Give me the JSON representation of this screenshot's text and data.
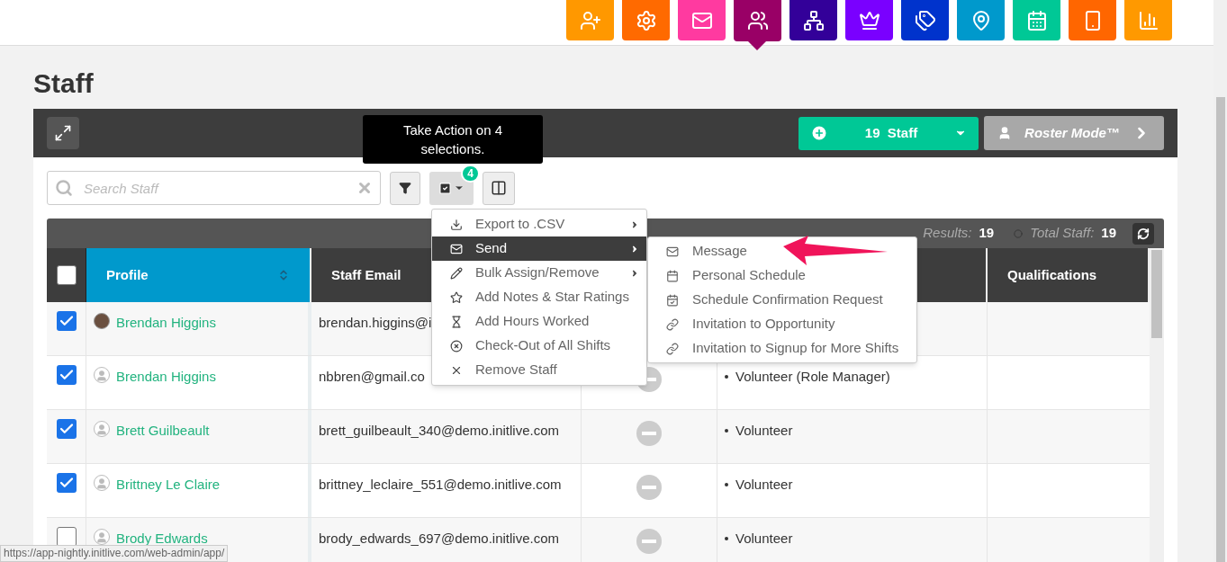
{
  "nav": [
    {
      "color": "#ff9800",
      "selected": false
    },
    {
      "color": "#ff6a00",
      "selected": false
    },
    {
      "color": "#ff3aa0",
      "selected": false
    },
    {
      "color": "#990066",
      "selected": true
    },
    {
      "color": "#330099",
      "selected": false
    },
    {
      "color": "#7a00ff",
      "selected": false
    },
    {
      "color": "#0033cc",
      "selected": false
    },
    {
      "color": "#0099cc",
      "selected": false
    },
    {
      "color": "#00c896",
      "selected": false
    },
    {
      "color": "#ff6600",
      "selected": false
    },
    {
      "color": "#ff9900",
      "selected": false
    }
  ],
  "page_title": "Staff",
  "top_bar": {
    "staff_button": "19  Staff",
    "roster_button": "Roster Mode™"
  },
  "search": {
    "placeholder": "Search Staff"
  },
  "action_badge": "4",
  "tooltip": "Take Action on 4 selections.",
  "stats": [
    {
      "label": "Results:",
      "value": "19"
    },
    {
      "label": "Total Staff:",
      "value": "19"
    }
  ],
  "table": {
    "all_selected": false,
    "columns": [
      {
        "label": "Profile",
        "sorted": true
      },
      {
        "label": "Staff Email",
        "sorted": false
      },
      {
        "sorted": false
      },
      {
        "label": "Qualifications",
        "sorted": false
      }
    ],
    "rows": [
      {
        "checked": true,
        "name": "Brendan Higgins",
        "photo": true,
        "email": "brendan.higgins@i",
        "minus": false,
        "roles": []
      },
      {
        "checked": true,
        "name": "Brendan Higgins",
        "photo": false,
        "email": "nbbren@gmail.co",
        "minus": true,
        "roles": [
          "Volunteer (Role Manager)"
        ]
      },
      {
        "checked": true,
        "name": "Brett Guilbeault",
        "photo": false,
        "email": "brett_guilbeault_340@demo.initlive.com",
        "minus": true,
        "roles": [
          "Volunteer"
        ]
      },
      {
        "checked": true,
        "name": "Brittney Le Claire",
        "photo": false,
        "email": "brittney_leclaire_551@demo.initlive.com",
        "minus": true,
        "roles": [
          "Volunteer"
        ]
      },
      {
        "checked": false,
        "name": "Brody Edwards",
        "photo": false,
        "email": "brody_edwards_697@demo.initlive.com",
        "minus": true,
        "roles": [
          "Volunteer"
        ]
      }
    ]
  },
  "action_menu": [
    {
      "label": "Export to .CSV",
      "submenu": true,
      "selected": false
    },
    {
      "label": "Send",
      "submenu": true,
      "selected": true
    },
    {
      "label": "Bulk Assign/Remove",
      "submenu": true,
      "selected": false
    },
    {
      "label": "Add Notes & Star Ratings",
      "submenu": false,
      "selected": false
    },
    {
      "label": "Add Hours Worked",
      "submenu": false,
      "selected": false
    },
    {
      "label": "Check-Out of All Shifts",
      "submenu": false,
      "selected": false
    },
    {
      "label": "Remove Staff",
      "submenu": false,
      "selected": false
    }
  ],
  "send_menu": [
    "Message",
    "Personal Schedule",
    "Schedule Confirmation Request",
    "Invitation to Opportunity",
    "Invitation to Signup for More Shifts"
  ],
  "status_url": "https://app-nightly.initlive.com/web-admin/app/"
}
